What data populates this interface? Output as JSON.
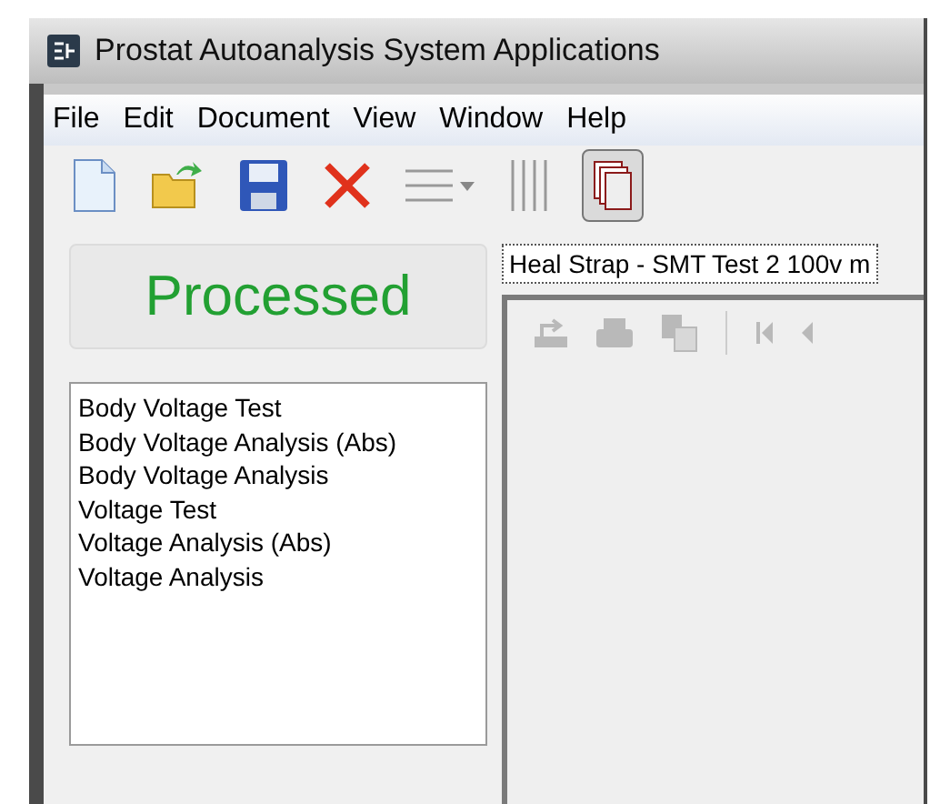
{
  "window": {
    "title": "Prostat Autoanalysis System Applications"
  },
  "menu": [
    "File",
    "Edit",
    "Document",
    "View",
    "Window",
    "Help"
  ],
  "toolbar": [
    {
      "kind": "new",
      "pressed": false
    },
    {
      "kind": "open",
      "pressed": false
    },
    {
      "kind": "save",
      "pressed": false
    },
    {
      "kind": "delete",
      "pressed": false
    },
    {
      "kind": "rows",
      "pressed": false
    },
    {
      "kind": "columns",
      "pressed": false
    },
    {
      "kind": "cascade",
      "pressed": true
    }
  ],
  "status": {
    "label": "Processed"
  },
  "tests": [
    {
      "label": "Body Voltage Test"
    },
    {
      "label": "Body Voltage Analysis (Abs)"
    },
    {
      "label": "Body Voltage Analysis"
    },
    {
      "label": "Voltage Test"
    },
    {
      "label": "Voltage Analysis (Abs)"
    },
    {
      "label": "Voltage Analysis"
    }
  ],
  "document_tab": {
    "label": "Heal Strap - SMT Test 2 100v m"
  },
  "viewer_toolbar": [
    {
      "kind": "export",
      "disabled": true
    },
    {
      "kind": "print",
      "disabled": true
    },
    {
      "kind": "copy",
      "disabled": true
    },
    {
      "kind": "first",
      "disabled": true
    },
    {
      "kind": "previous",
      "disabled": true
    }
  ]
}
